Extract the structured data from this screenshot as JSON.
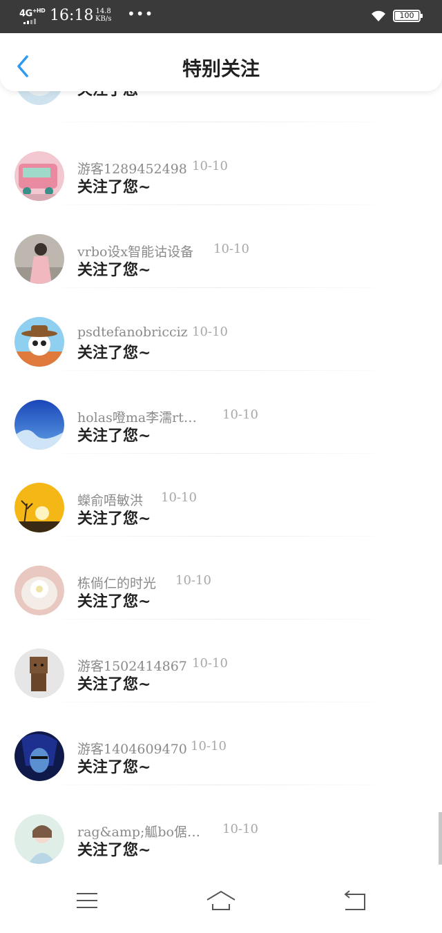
{
  "status_bar": {
    "network": "4G",
    "network_sup": "+HD",
    "time": "16:18",
    "speed_value": "14.8",
    "speed_unit": "KB/s",
    "more": "•••",
    "battery": "100"
  },
  "header": {
    "title": "特别关注",
    "back_icon": "chevron-left-icon",
    "accent_color": "#2a9bf0"
  },
  "list": {
    "partial_item": {
      "message": "关注了您~"
    },
    "items": [
      {
        "name": "游客1289452498",
        "date": "10-10",
        "message": "关注了您~",
        "avatar": "bus-avatar"
      },
      {
        "name": "vrbo设x智能诂设备",
        "date": "10-10",
        "message": "关注了您~",
        "avatar": "girl-pink-avatar"
      },
      {
        "name": "psdtefanobricciz",
        "date": "10-10",
        "message": "关注了您~",
        "avatar": "panda-avatar"
      },
      {
        "name": "holas噔ma李濡rt…",
        "date": "10-10",
        "message": "关注了您~",
        "avatar": "blue-sea-avatar"
      },
      {
        "name": "蠑俞唔敏洪",
        "date": "10-10",
        "message": "关注了您~",
        "avatar": "sunset-avatar"
      },
      {
        "name": "栋倘仁的时光",
        "date": "10-10",
        "message": "关注了您~",
        "avatar": "flower-cup-avatar"
      },
      {
        "name": "游客1502414867",
        "date": "10-10",
        "message": "关注了您~",
        "avatar": "box-robot-avatar"
      },
      {
        "name": "游客1404609470",
        "date": "10-10",
        "message": "关注了您~",
        "avatar": "anime-avatar"
      },
      {
        "name": "rag&amp;觚bo倨…",
        "date": "10-10",
        "message": "关注了您~",
        "avatar": "girl-portrait-avatar"
      }
    ]
  },
  "nav_bar": {
    "menu_icon": "menu-icon",
    "home_icon": "home-icon",
    "back_icon": "back-arrow-icon"
  }
}
